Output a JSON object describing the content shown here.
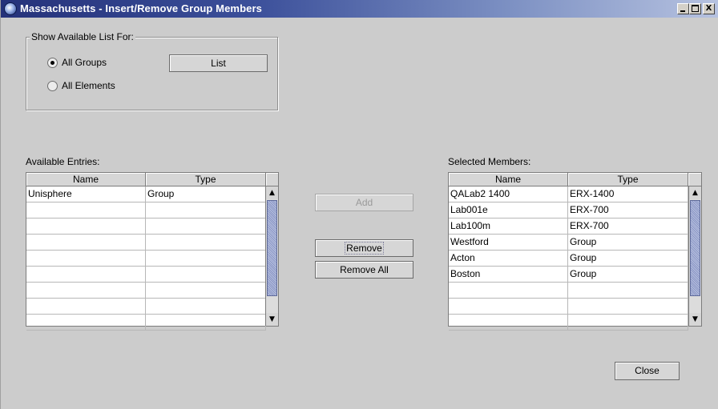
{
  "window": {
    "title": "Massachusetts - Insert/Remove Group Members",
    "controls": {
      "minimize": "_",
      "maximize": "□",
      "close": "X"
    }
  },
  "show_available": {
    "legend": "Show Available List For:",
    "options": [
      {
        "label": "All Groups",
        "checked": true
      },
      {
        "label": "All Elements",
        "checked": false
      }
    ],
    "list_button": "List"
  },
  "available": {
    "label": "Available Entries:",
    "columns": [
      "Name",
      "Type"
    ],
    "rows": [
      [
        "Unisphere",
        "Group"
      ],
      [
        "",
        ""
      ],
      [
        "",
        ""
      ],
      [
        "",
        ""
      ],
      [
        "",
        ""
      ],
      [
        "",
        ""
      ],
      [
        "",
        ""
      ],
      [
        "",
        ""
      ],
      [
        "",
        ""
      ]
    ]
  },
  "actions": {
    "add": "Add",
    "remove": "Remove",
    "remove_all": "Remove All"
  },
  "selected": {
    "label": "Selected Members:",
    "columns": [
      "Name",
      "Type"
    ],
    "rows": [
      [
        "QALab2 1400",
        "ERX-1400"
      ],
      [
        "Lab001e",
        "ERX-700"
      ],
      [
        "Lab100m",
        "ERX-700"
      ],
      [
        "Westford",
        "Group"
      ],
      [
        "Acton",
        "Group"
      ],
      [
        "Boston",
        "Group"
      ],
      [
        "",
        ""
      ],
      [
        "",
        ""
      ],
      [
        "",
        ""
      ]
    ]
  },
  "close_button": "Close",
  "icons": {
    "scroll_up": "▲",
    "scroll_down": "▼"
  }
}
